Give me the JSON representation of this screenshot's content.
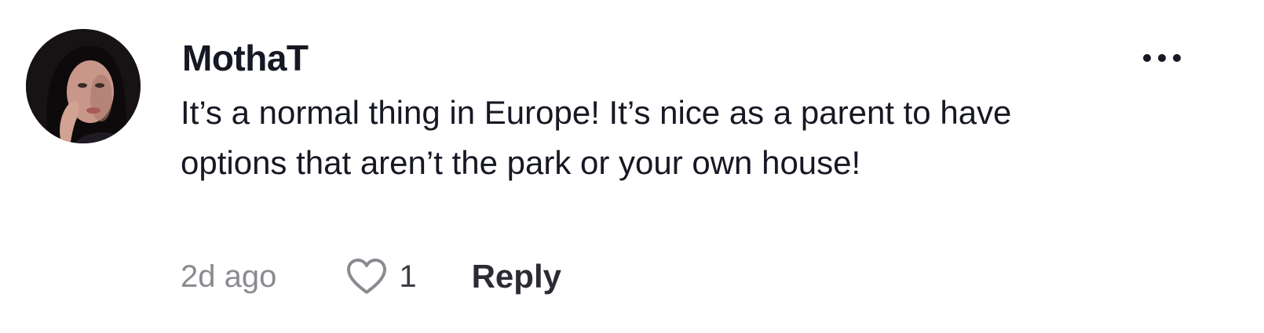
{
  "comment": {
    "username": "MothaT",
    "text": "It’s a normal thing in Europe! It’s nice as a parent to have options that aren’t the park or your own house!",
    "timestamp": "2d ago",
    "like_count": "1",
    "reply_label": "Reply"
  },
  "icons": {
    "more": "more-horizontal-icon",
    "like": "heart-outline-icon",
    "avatar": "user-avatar"
  },
  "colors": {
    "primary_text": "#161823",
    "secondary_text": "#8a8b91",
    "heart_stroke": "#8a8b91",
    "background": "#ffffff"
  }
}
